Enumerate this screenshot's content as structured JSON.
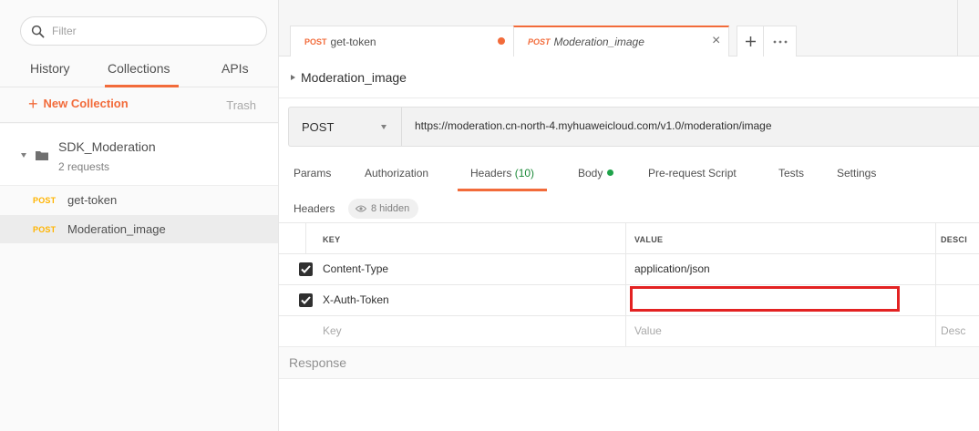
{
  "sidebar": {
    "filter_placeholder": "Filter",
    "tabs": [
      {
        "label": "History"
      },
      {
        "label": "Collections"
      },
      {
        "label": "APIs"
      }
    ],
    "new_collection_label": "New Collection",
    "trash_label": "Trash",
    "collection": {
      "name": "SDK_Moderation",
      "count": "2 requests"
    },
    "requests": [
      {
        "method": "POST",
        "name": "get-token"
      },
      {
        "method": "POST",
        "name": "Moderation_image"
      }
    ]
  },
  "tabs": [
    {
      "method": "POST",
      "name": "get-token"
    },
    {
      "method": "POST",
      "name": "Moderation_image"
    }
  ],
  "request": {
    "title": "Moderation_image",
    "method": "POST",
    "url": "https://moderation.cn-north-4.myhuaweicloud.com/v1.0/moderation/image"
  },
  "subtabs": {
    "params": "Params",
    "authorization": "Authorization",
    "headers": "Headers",
    "headers_count": "(10)",
    "body": "Body",
    "prerequest": "Pre-request Script",
    "tests": "Tests",
    "settings": "Settings"
  },
  "headers_section": {
    "label": "Headers",
    "hidden": "8 hidden"
  },
  "table": {
    "columns": {
      "key": "KEY",
      "value": "VALUE",
      "description": "DESCI"
    },
    "rows": [
      {
        "key": "Content-Type",
        "value": "application/json",
        "checked": true
      },
      {
        "key": "X-Auth-Token",
        "value": "",
        "checked": true
      }
    ],
    "placeholders": {
      "key": "Key",
      "value": "Value",
      "description": "Desc"
    }
  },
  "response_label": "Response",
  "colors": {
    "accent": "#f26b3a",
    "method_yellow": "#ffb400",
    "highlight": "#e32222",
    "green": "#1fa34a"
  }
}
